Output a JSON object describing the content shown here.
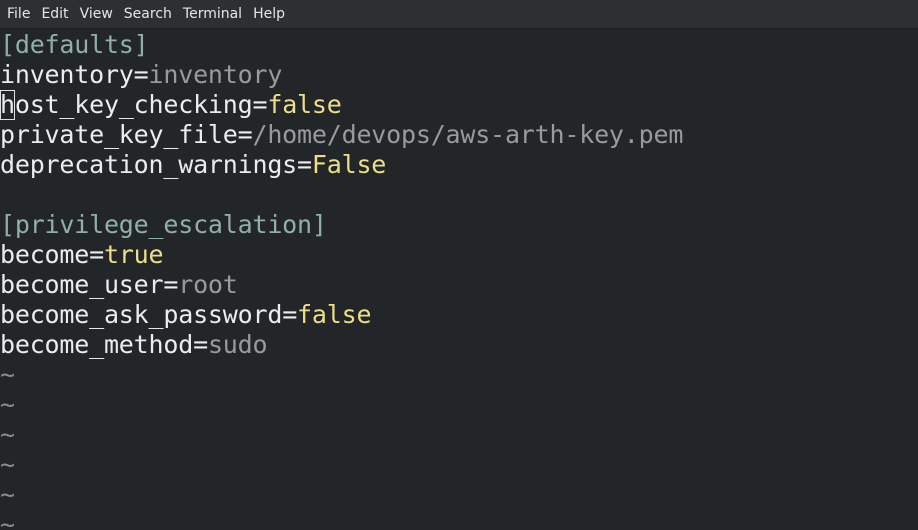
{
  "menu": [
    "File",
    "Edit",
    "View",
    "Search",
    "Terminal",
    "Help"
  ],
  "lines": [
    {
      "type": "section",
      "text": "[defaults]"
    },
    {
      "type": "kv",
      "key": "inventory",
      "value": "inventory",
      "vclass": "val-str"
    },
    {
      "type": "kv",
      "key": "host_key_checking",
      "value": "false",
      "vclass": "val-bool",
      "cursor": 1
    },
    {
      "type": "kv",
      "key": "private_key_file",
      "value": "/home/devops/aws-arth-key.pem",
      "vclass": "val-str"
    },
    {
      "type": "kv",
      "key": "deprecation_warnings",
      "value": "False",
      "vclass": "val-bool"
    },
    {
      "type": "blank"
    },
    {
      "type": "section",
      "text": "[privilege_escalation]"
    },
    {
      "type": "kv",
      "key": "become",
      "value": "true",
      "vclass": "val-bool"
    },
    {
      "type": "kv",
      "key": "become_user",
      "value": "root",
      "vclass": "val-str"
    },
    {
      "type": "kv",
      "key": "become_ask_password",
      "value": "false",
      "vclass": "val-bool"
    },
    {
      "type": "kv",
      "key": "become_method",
      "value": "sudo",
      "vclass": "val-str"
    },
    {
      "type": "tilde",
      "text": "~"
    },
    {
      "type": "tilde",
      "text": "~"
    },
    {
      "type": "tilde",
      "text": "~"
    },
    {
      "type": "tilde",
      "text": "~"
    },
    {
      "type": "tilde",
      "text": "~"
    },
    {
      "type": "tilde",
      "text": "~"
    }
  ],
  "colors": {
    "background": "#232628",
    "section": "#8fb0a3",
    "key": "#ececec",
    "string_value": "#9a9a9a",
    "bool_value": "#ecde8a"
  }
}
